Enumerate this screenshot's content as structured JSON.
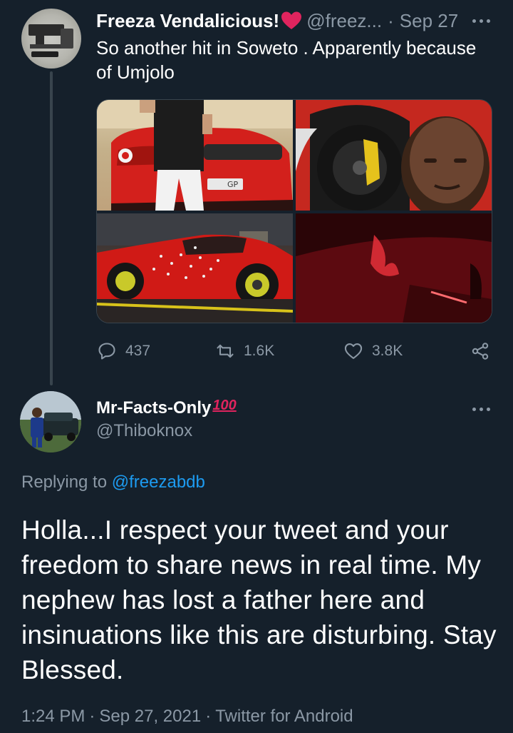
{
  "tweet1": {
    "author_name": "Freeza Vendalicious!",
    "author_emoji": "heart-emoji",
    "handle": "@freez...",
    "separator": "·",
    "date": "Sep 27",
    "text": "So another hit in Soweto . Apparently because of Umjolo",
    "stats": {
      "replies": "437",
      "retweets": "1.6K",
      "likes": "3.8K"
    },
    "plate_text": "GP"
  },
  "tweet2": {
    "author_name": "Mr-Facts-Only",
    "author_badge": "100",
    "handle": "@Thiboknox",
    "replying_prefix": "Replying to",
    "replying_handle": "@freezabdb",
    "text": "Holla...I respect your tweet and your freedom to share news in real time. My nephew has lost a father here and insinuations like this are disturbing. Stay Blessed.",
    "time": "1:24 PM",
    "date": "Sep 27, 2021",
    "source": "Twitter for Android",
    "separator": "·"
  },
  "colors": {
    "background": "#15202b",
    "secondary_text": "#8b98a5",
    "link": "#1d9bf0",
    "divider": "#38444d"
  },
  "icons": [
    "reply-icon",
    "retweet-icon",
    "like-icon",
    "share-icon",
    "more-icon"
  ]
}
